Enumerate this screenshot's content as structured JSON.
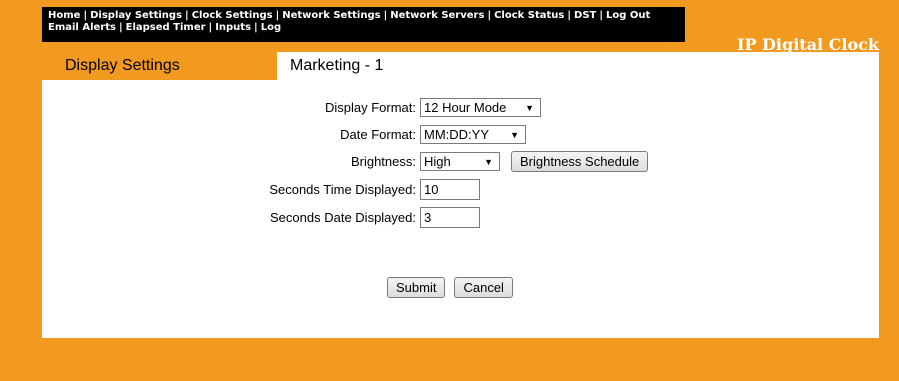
{
  "nav": {
    "line1": [
      "Home",
      "Display Settings",
      "Clock Settings",
      "Network Settings",
      "Network Servers",
      "Clock Status",
      "DST",
      "Log Out"
    ],
    "line2": [
      "Email Alerts",
      "Elapsed Timer",
      "Inputs",
      "Log"
    ],
    "separator": "|"
  },
  "brand": "IP Digital Clock",
  "section_title": "Display Settings",
  "device_name": "Marketing - 1",
  "form": {
    "display_format": {
      "label": "Display Format:",
      "value": "12 Hour Mode"
    },
    "date_format": {
      "label": "Date Format:",
      "value": "MM:DD:YY"
    },
    "brightness": {
      "label": "Brightness:",
      "value": "High"
    },
    "brightness_schedule_button": "Brightness Schedule",
    "seconds_time": {
      "label": "Seconds Time Displayed:",
      "value": "10"
    },
    "seconds_date": {
      "label": "Seconds Date Displayed:",
      "value": "3"
    },
    "submit": "Submit",
    "cancel": "Cancel"
  },
  "colors": {
    "background": "#f29a1f",
    "nav": "#000000",
    "panel": "#ffffff"
  }
}
